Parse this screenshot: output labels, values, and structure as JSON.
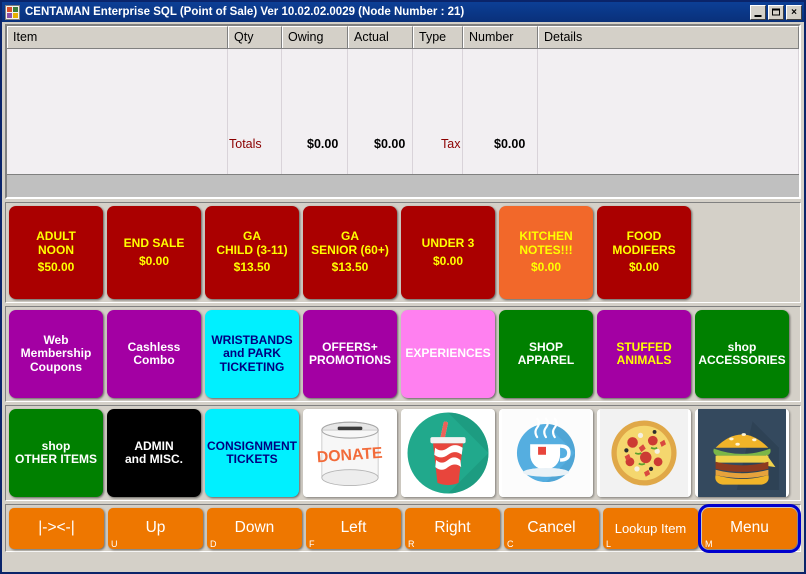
{
  "window": {
    "title": "CENTAMAN Enterprise SQL (Point of Sale) Ver 10.02.02.0029   (Node Number : 21)",
    "minimize_label": "_",
    "maximize_label": "□",
    "close_label": "X"
  },
  "grid": {
    "columns": [
      "Item",
      "Qty",
      "Owing",
      "Actual",
      "Type",
      "Number",
      "Details"
    ],
    "rows": [],
    "totals": {
      "label": "Totals",
      "owing": "$0.00",
      "actual": "$0.00",
      "tax_label": "Tax",
      "tax": "$0.00"
    }
  },
  "tile_rows": [
    {
      "row": 1,
      "tiles": [
        {
          "label": "ADULT\nNOON",
          "amount": "$50.00",
          "bg": "#aa0000",
          "fg": "#ffff00"
        },
        {
          "label": "END SALE",
          "amount": "$0.00",
          "bg": "#aa0000",
          "fg": "#ffff00"
        },
        {
          "label": "GA\nCHILD (3-11)",
          "amount": "$13.50",
          "bg": "#aa0000",
          "fg": "#ffff00"
        },
        {
          "label": "GA\nSENIOR (60+)",
          "amount": "$13.50",
          "bg": "#aa0000",
          "fg": "#ffff00"
        },
        {
          "label": "UNDER 3",
          "amount": "$0.00",
          "bg": "#aa0000",
          "fg": "#ffff00"
        },
        {
          "label": "KITCHEN\nNOTES!!!",
          "amount": "$0.00",
          "bg": "#f2682a",
          "fg": "#ffff00"
        },
        {
          "label": "FOOD\nMODIFERS",
          "amount": "$0.00",
          "bg": "#aa0000",
          "fg": "#ffff00"
        }
      ]
    },
    {
      "row": 2,
      "tiles": [
        {
          "label": "Web\nMembership\nCoupons",
          "amount": "",
          "bg": "#a300a3",
          "fg": "#ffffff"
        },
        {
          "label": "Cashless\nCombo",
          "amount": "",
          "bg": "#a300a3",
          "fg": "#ffffff"
        },
        {
          "label": "WRISTBANDS\nand PARK\nTICKETING",
          "amount": "",
          "bg": "#00f0ff",
          "fg": "#000080"
        },
        {
          "label": "OFFERS+\nPROMOTIONS",
          "amount": "",
          "bg": "#a300a3",
          "fg": "#ffffff"
        },
        {
          "label": "EXPERIENCES",
          "amount": "",
          "bg": "#ff80f0",
          "fg": "#ffffff"
        },
        {
          "label": "SHOP\nAPPAREL",
          "amount": "",
          "bg": "#008000",
          "fg": "#ffffff"
        },
        {
          "label": "STUFFED\nANIMALS",
          "amount": "",
          "bg": "#a300a3",
          "fg": "#ffff00"
        },
        {
          "label": "shop\nACCESSORIES",
          "amount": "",
          "bg": "#008000",
          "fg": "#ffffff"
        }
      ]
    },
    {
      "row": 3,
      "tiles": [
        {
          "label": "shop\nOTHER ITEMS",
          "amount": "",
          "bg": "#008000",
          "fg": "#ffffff"
        },
        {
          "label": "ADMIN\nand MISC.",
          "amount": "",
          "bg": "#000000",
          "fg": "#ffffff"
        },
        {
          "label": "CONSIGNMENT\nTICKETS",
          "amount": "",
          "bg": "#00f0ff",
          "fg": "#000080"
        },
        {
          "icon": "donation-can-image",
          "label": "DONATE"
        },
        {
          "icon": "soda-cup-image",
          "label": ""
        },
        {
          "icon": "tea-cup-image",
          "label": ""
        },
        {
          "icon": "pizza-image",
          "label": ""
        },
        {
          "icon": "burger-image",
          "label": ""
        }
      ]
    }
  ],
  "toolbar": {
    "buttons": [
      {
        "label": "|-><-|",
        "key": ""
      },
      {
        "label": "Up",
        "key": "U"
      },
      {
        "label": "Down",
        "key": "D"
      },
      {
        "label": "Left",
        "key": "F"
      },
      {
        "label": "Right",
        "key": "R"
      },
      {
        "label": "Cancel",
        "key": "C"
      },
      {
        "label": "Lookup Item",
        "key": "L"
      },
      {
        "label": "Menu",
        "key": "M",
        "focused": true
      }
    ]
  },
  "colors": {
    "titlebar": "#0a3f96",
    "toolbar_orange": "#ee7700",
    "focus_ring": "#0000cd",
    "window_face": "#d4d0c8"
  }
}
